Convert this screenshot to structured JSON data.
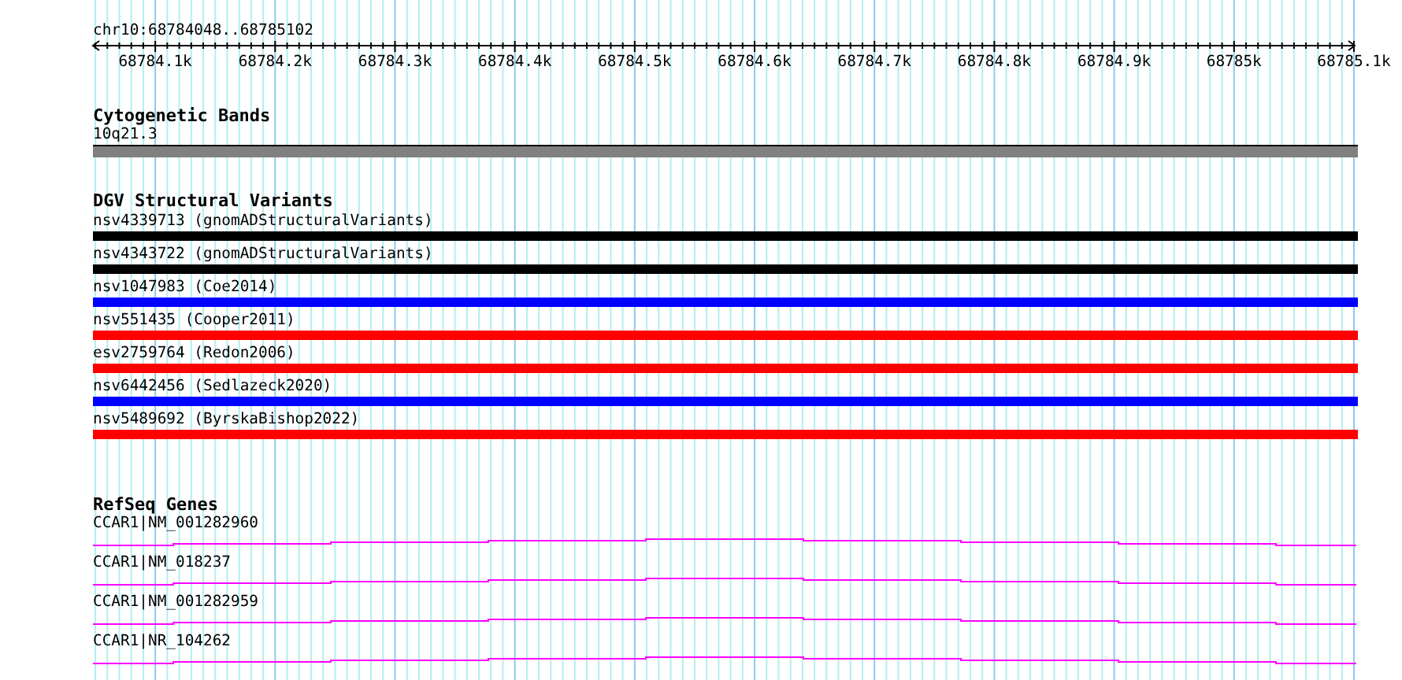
{
  "ruler": {
    "location": "chr10:68784048..68785102",
    "ticks": [
      "68784.1k",
      "68784.2k",
      "68784.3k",
      "68784.4k",
      "68784.5k",
      "68784.6k",
      "68784.7k",
      "68784.8k",
      "68784.9k",
      "68785k",
      "68785.1k"
    ]
  },
  "cytogenetic_bands": {
    "title": "Cytogenetic Bands",
    "bands": [
      {
        "label": "10q21.3"
      }
    ]
  },
  "dgv_structural_variants": {
    "title": "DGV Structural Variants",
    "variants": [
      {
        "label": "nsv4339713 (gnomADStructuralVariants)",
        "color": "#000000"
      },
      {
        "label": "nsv4343722 (gnomADStructuralVariants)",
        "color": "#000000"
      },
      {
        "label": "nsv1047983 (Coe2014)",
        "color": "#0000ff"
      },
      {
        "label": "nsv551435 (Cooper2011)",
        "color": "#ff0000"
      },
      {
        "label": "esv2759764 (Redon2006)",
        "color": "#ff0000"
      },
      {
        "label": "nsv6442456 (Sedlazeck2020)",
        "color": "#0000ff"
      },
      {
        "label": "nsv5489692 (ByrskaBishop2022)",
        "color": "#ff0000"
      }
    ]
  },
  "refseq_genes": {
    "title": "RefSeq Genes",
    "genes": [
      {
        "label": "CCAR1|NM_001282960"
      },
      {
        "label": "CCAR1|NM_018237"
      },
      {
        "label": "CCAR1|NM_001282959"
      },
      {
        "label": "CCAR1|NR_104262"
      }
    ]
  }
}
